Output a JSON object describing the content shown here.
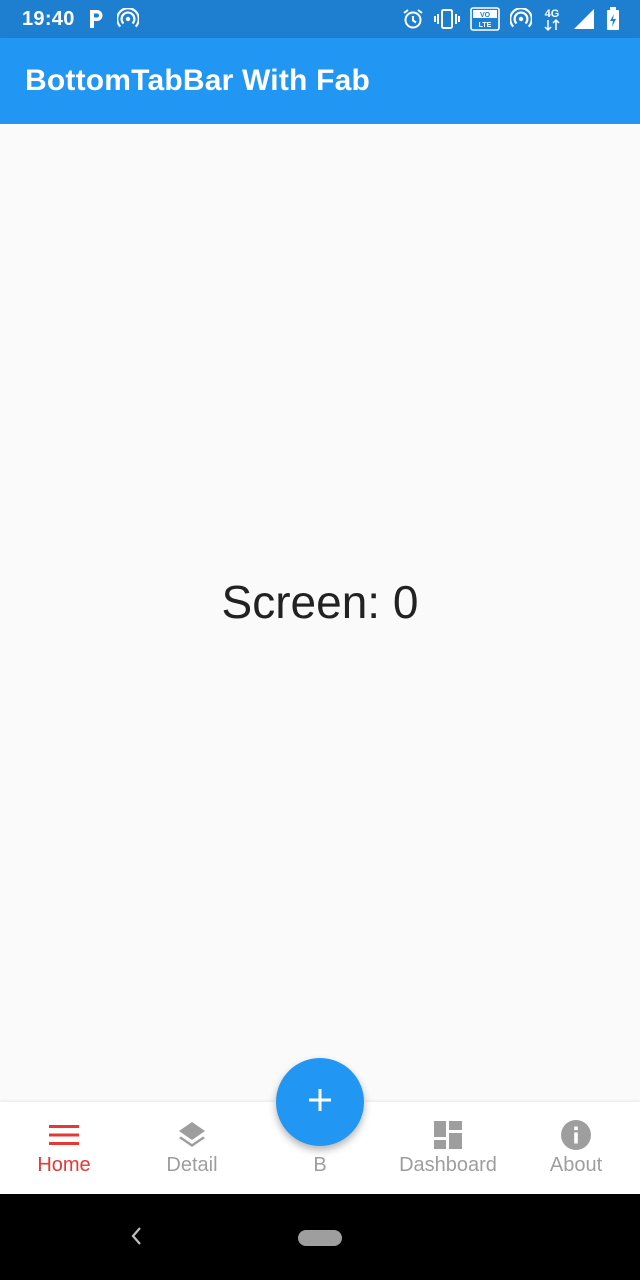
{
  "status_bar": {
    "time": "19:40",
    "network_label": "4G",
    "volte_label": "VO LTE",
    "icons": [
      "parking-icon",
      "hotspot-icon",
      "alarm-icon",
      "vibrate-icon",
      "volte-icon",
      "hotspot-icon",
      "4g-icon",
      "signal-icon",
      "battery-icon"
    ]
  },
  "app_bar": {
    "title": "BottomTabBar With Fab"
  },
  "main": {
    "screen_text": "Screen: 0"
  },
  "bottom_nav": {
    "tabs": [
      {
        "label": "Home",
        "icon": "menu-icon",
        "active": true
      },
      {
        "label": "Detail",
        "icon": "layers-icon",
        "active": false
      },
      {
        "label": "B",
        "icon": "",
        "active": false
      },
      {
        "label": "Dashboard",
        "icon": "dashboard-icon",
        "active": false
      },
      {
        "label": "About",
        "icon": "info-icon",
        "active": false
      }
    ],
    "fab_icon": "add-icon"
  },
  "colors": {
    "primary": "#2196f3",
    "status_bar": "#1e7fd1",
    "active_tab": "#e53935",
    "inactive_tab": "#9e9e9e",
    "background": "#fafafa"
  }
}
